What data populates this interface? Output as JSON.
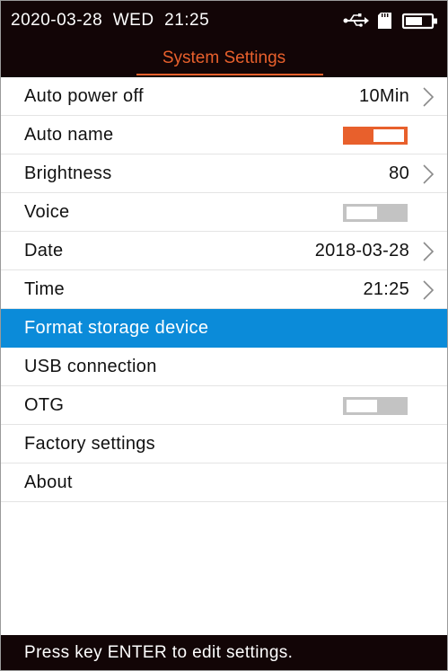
{
  "colors": {
    "bar_background": "#120506",
    "accent": "#e8602c",
    "selection": "#0b8bd9",
    "toggle_off": "#c3c3c3",
    "text": "#111111"
  },
  "status_bar": {
    "datetime": "2020-03-28  WED  21:25",
    "icons": [
      "usb-icon",
      "sd-card-icon",
      "battery-icon"
    ]
  },
  "header": {
    "title": "System Settings"
  },
  "menu": {
    "items": [
      {
        "label": "Auto power off",
        "value": "10Min"
      },
      {
        "label": "Auto name",
        "toggle": "on"
      },
      {
        "label": "Brightness",
        "value": "80"
      },
      {
        "label": "Voice",
        "toggle": "off"
      },
      {
        "label": "Date",
        "value": "2018-03-28"
      },
      {
        "label": "Time",
        "value": "21:25"
      },
      {
        "label": "Format storage device",
        "selected": true
      },
      {
        "label": "USB connection"
      },
      {
        "label": "OTG",
        "toggle": "off"
      },
      {
        "label": "Factory settings"
      },
      {
        "label": "About"
      }
    ]
  },
  "footer": {
    "hint": "Press key ENTER to edit settings."
  }
}
